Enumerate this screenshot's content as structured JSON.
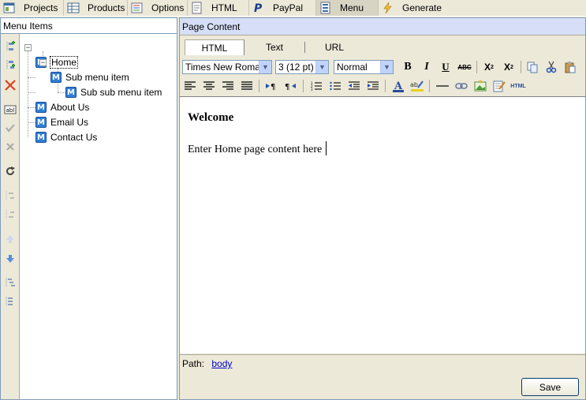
{
  "top_tabs": [
    {
      "label": "Projects",
      "icon": "projects-icon"
    },
    {
      "label": "Products",
      "icon": "products-icon"
    },
    {
      "label": "Options",
      "icon": "options-icon"
    },
    {
      "label": "HTML",
      "icon": "html-icon"
    },
    {
      "label": "PayPal",
      "icon": "paypal-icon"
    },
    {
      "label": "Menu",
      "icon": "menu-icon"
    },
    {
      "label": "Generate",
      "icon": "generate-icon"
    }
  ],
  "active_top_tab": "Menu",
  "left_pane": {
    "title": "Menu Items",
    "tree": [
      {
        "label": "Home",
        "level": 0,
        "selected": true
      },
      {
        "label": "Sub menu item",
        "level": 1
      },
      {
        "label": "Sub sub menu item",
        "level": 2
      },
      {
        "label": "About Us",
        "level": 0
      },
      {
        "label": "Email Us",
        "level": 0
      },
      {
        "label": "Contact Us",
        "level": 0
      }
    ],
    "toolbar_icons": [
      "add-item-icon",
      "add-child-icon",
      "delete-icon",
      "rename-icon",
      "confirm-icon",
      "cancel-icon",
      "refresh-icon",
      "indent-icon",
      "outdent-icon",
      "move-up-icon",
      "move-down-icon",
      "expand-icon",
      "collapse-icon"
    ]
  },
  "right_pane": {
    "title": "Page Content",
    "mode_tabs": [
      "HTML",
      "Text",
      "URL"
    ],
    "active_mode": "HTML",
    "font_family": "Times New Roman",
    "font_size": "3 (12 pt)",
    "paragraph_style": "Normal",
    "editor": {
      "heading": "Welcome",
      "body": "Enter Home page content here"
    },
    "path_label": "Path:",
    "path_value": "body",
    "save_label": "Save"
  },
  "colors": {
    "window_bg": "#ece9d8",
    "header_blue": "#d6dff7",
    "border": "#7f9db9",
    "menu_icon_blue": "#2f7fd6",
    "link": "#0000cc"
  }
}
